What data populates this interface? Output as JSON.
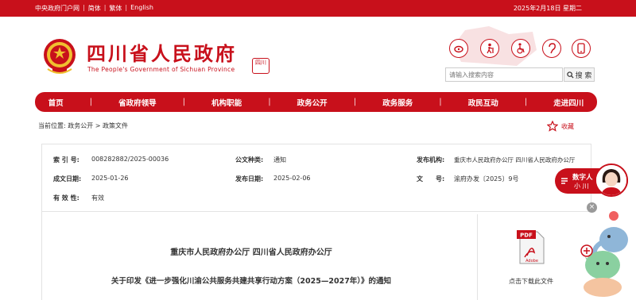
{
  "topbar": {
    "links": [
      "中央政府门户网",
      "简体",
      "繁体",
      "English"
    ],
    "date": "2025年2月18日 星期二"
  },
  "header": {
    "title": "四川省人民政府",
    "subtitle": "The People's Government of Sichuan Province",
    "seal_text": "四川"
  },
  "search": {
    "placeholder": "请输入搜索内容",
    "button": "搜 索"
  },
  "nav": [
    "首页",
    "省政府领导",
    "机构职能",
    "政务公开",
    "政务服务",
    "政民互动",
    "走进四川"
  ],
  "breadcrumb": {
    "prefix": "当前位置:",
    "items": [
      "政务公开",
      "政策文件"
    ],
    "sep": ">"
  },
  "favorite": "收藏",
  "meta": {
    "index_label": "索 引 号:",
    "index_value": "008282882/2025-00036",
    "category_label": "公文种类:",
    "category_value": "通知",
    "issuer_label": "发布机构:",
    "issuer_value": "重庆市人民政府办公厅 四川省人民政府办公厅",
    "created_label": "成文日期:",
    "created_value": "2025-01-26",
    "published_label": "发布日期:",
    "published_value": "2025-02-06",
    "docno_label": "文　　号:",
    "docno_value": "渝府办发〔2025〕9号",
    "validity_label": "有 效 性:",
    "validity_value": "有效"
  },
  "document": {
    "org": "重庆市人民政府办公厅  四川省人民政府办公厅",
    "title": "关于印发《进一步强化川渝公共服务共建共享行动方案（2025—2027年）》的通知",
    "pdf_badge": "PDF",
    "download": "点击下载此文件"
  },
  "assistant": {
    "line1": "数字人",
    "line2": "小 川"
  },
  "colors": {
    "brand_red": "#c8101b"
  }
}
